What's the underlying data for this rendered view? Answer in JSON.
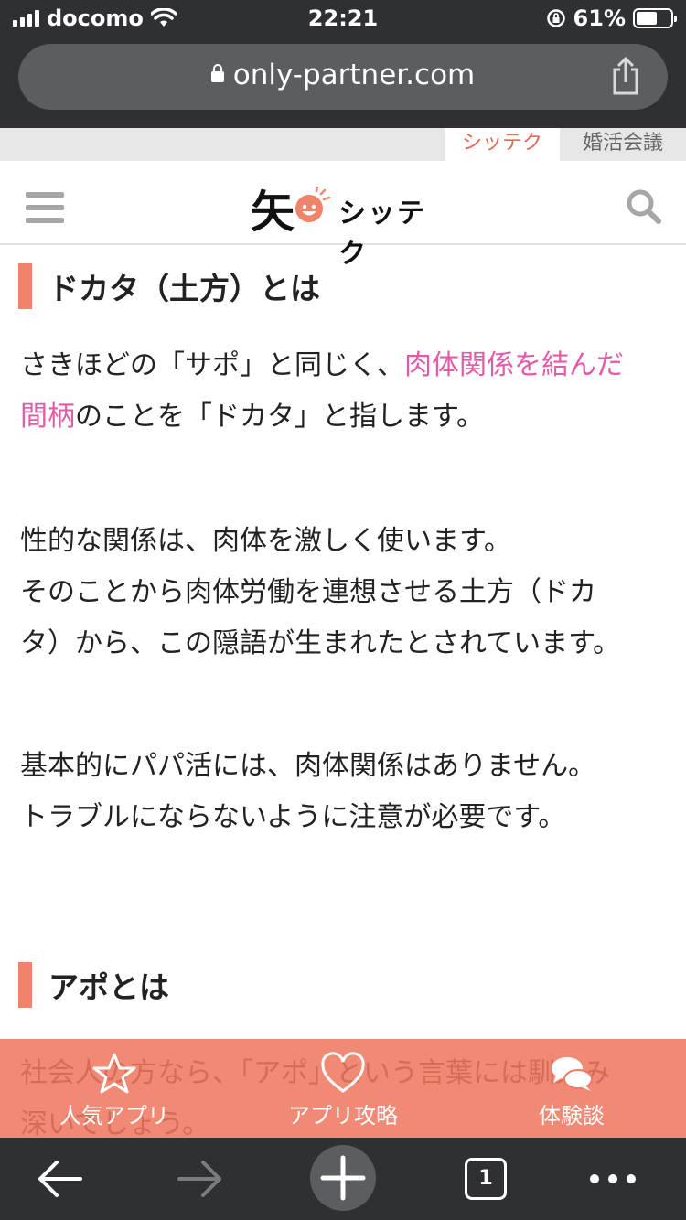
{
  "status_bar": {
    "carrier": "docomo",
    "time": "22:21",
    "battery_percent": "61%",
    "battery_level": 0.61
  },
  "browser": {
    "url": "only-partner.com",
    "tab_count": "1"
  },
  "site_tabs": {
    "active": "シッテク",
    "inactive": "婚活会議"
  },
  "site_header": {
    "logo_kanji": "矢",
    "logo_text": "シッテク"
  },
  "article": {
    "section1_heading": "ドカタ（土方）とは",
    "p1_line1_a": "さきほどの「サポ」と同じく、",
    "p1_link_line1": "肉体関係を結んだ",
    "p1_link_line2": "間柄",
    "p1_line2_b": "のことを「ドカタ」と指します。",
    "p2_line1": "性的な関係は、肉体を激しく使います。",
    "p2_line2": "そのことから肉体労働を連想させる土方（ドカ",
    "p2_line3": "タ）から、この隠語が生まれたとされています。",
    "p3_line1": "基本的にパパ活には、肉体関係はありません。",
    "p3_line2": "トラブルにならないように注意が必要です。",
    "section2_heading": "アポとは",
    "p4_line1": "社会人の方なら、「アポ」という言葉には馴染み",
    "p4_line2": "深いでしょう。"
  },
  "site_nav": {
    "items": [
      {
        "label": "人気アプリ",
        "icon": "star-icon"
      },
      {
        "label": "アプリ攻略",
        "icon": "heart-icon"
      },
      {
        "label": "体験談",
        "icon": "chat-bubbles-icon"
      }
    ]
  },
  "colors": {
    "accent": "#f0846a",
    "link": "#e45aa7",
    "chrome": "#2e3033",
    "nav_bg": "#ee7a62"
  }
}
